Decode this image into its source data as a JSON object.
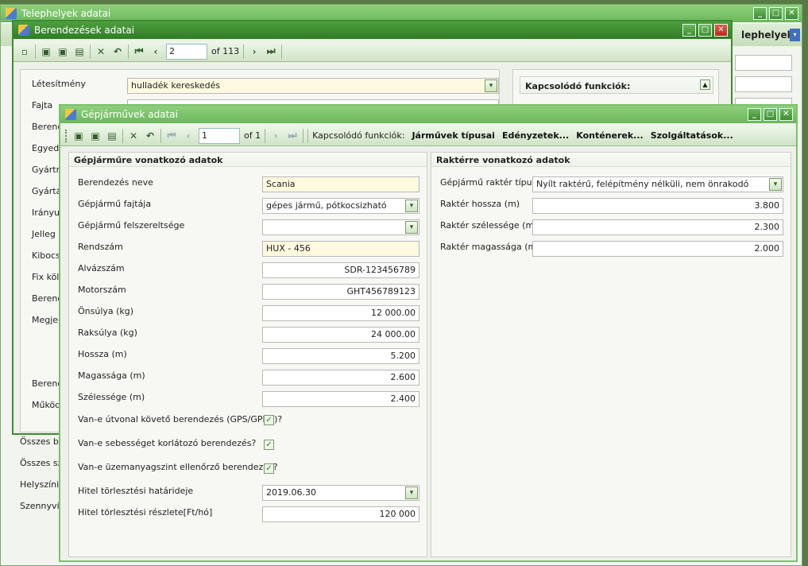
{
  "window1": {
    "title": "Telephelyek adatai",
    "right_label": "lephelyek"
  },
  "window2": {
    "title": "Berendezések adatai",
    "nav": {
      "current": "2",
      "of": "of 113"
    },
    "fields": [
      {
        "label": "Létesítmény",
        "value": "hulladék kereskedés"
      },
      {
        "label": "Fajta"
      },
      {
        "label": "Berende"
      },
      {
        "label": "Egyedi"
      },
      {
        "label": "Gyártm"
      },
      {
        "label": "Gyártás"
      },
      {
        "label": "Irányult"
      },
      {
        "label": "Jelleg"
      },
      {
        "label": "Kibocsá"
      },
      {
        "label": "Fix költs"
      },
      {
        "label": "Berende"
      },
      {
        "label": "Megjeg"
      },
      {
        "label": "Berende"
      },
      {
        "label": "Működé"
      }
    ],
    "kapcs_title": "Kapcsolódó funkciók:"
  },
  "bg_labels": [
    "Összes b",
    "Összes szil",
    "Helyszíni v",
    "Szennyvíz"
  ],
  "window3": {
    "title": "Gépjárművek adatai",
    "nav": {
      "current": "1",
      "of": "of 1"
    },
    "kapcs_label": "Kapcsolódó funkciók:",
    "links": [
      "Járművek típusai",
      "Edényzetek...",
      "Konténerek...",
      "Szolgáltatások..."
    ],
    "left_panel": {
      "title": "Gépjárműre vonatkozó adatok",
      "rows": [
        {
          "label": "Berendezés neve",
          "value": "Scania"
        },
        {
          "label": "Gépjármű fajtája",
          "value": "gépes jármű, pótkocsizható"
        },
        {
          "label": "Gépjármű felszereltsége",
          "value": ""
        },
        {
          "label": "Rendszám",
          "value": "HUX - 456"
        },
        {
          "label": "Alvázszám",
          "value": "SDR-123456789"
        },
        {
          "label": "Motorszám",
          "value": "GHT456789123"
        },
        {
          "label": "Önsúlya (kg)",
          "value": "12 000.00"
        },
        {
          "label": "Raksúlya  (kg)",
          "value": "24 000.00"
        },
        {
          "label": "Hossza (m)",
          "value": "5.200"
        },
        {
          "label": "Magassága (m)",
          "value": "2.600"
        },
        {
          "label": "Szélessége  (m)",
          "value": "2.400"
        }
      ],
      "checks": [
        {
          "label": "Van-e útvonal követő berendezés (GPS/GPRS)?",
          "checked": true
        },
        {
          "label": "Van-e sebességet korlátozó berendezés?",
          "checked": true
        },
        {
          "label": "Van-e üzemanyagszint ellenőrző berendezes?",
          "checked": true
        }
      ],
      "hitel_hatarido": {
        "label": "Hitel törlesztési határideje",
        "value": "2019.06.30"
      },
      "hitel_reszlet": {
        "label": "Hitel törlesztési részlete[Ft/hó]",
        "value": "120 000"
      }
    },
    "right_panel": {
      "title": "Raktérre vonatkozó adatok",
      "rows": [
        {
          "label": "Gépjármű raktér típusa",
          "value": "Nyílt raktérű, felépítmény nélküli, nem önrakodó"
        },
        {
          "label": "Raktér hossza  (m)",
          "value": "3.800"
        },
        {
          "label": "Raktér szélessége  (m)",
          "value": "2.300"
        },
        {
          "label": "Raktér magassága  (m)",
          "value": "2.000"
        }
      ]
    }
  },
  "colors": {
    "accent": "#2e7d24",
    "yellow_field": "#fffadf",
    "background": "#4f6b3a"
  }
}
